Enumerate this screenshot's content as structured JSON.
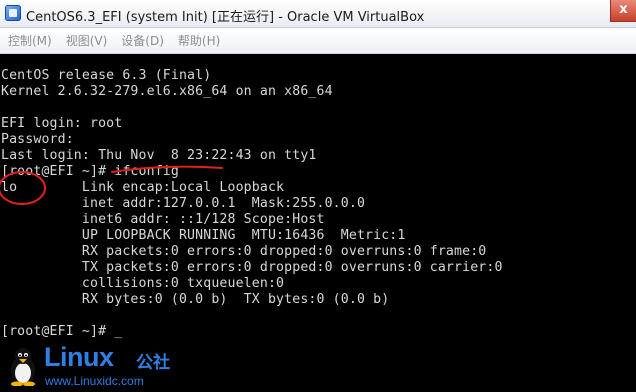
{
  "window": {
    "title": "CentOS6.3_EFI (system Init) [正在运行] - Oracle VM VirtualBox",
    "close_label": "x",
    "app_icon": "virtualbox-icon"
  },
  "menu": {
    "items": [
      {
        "label": "控制(M)"
      },
      {
        "label": "视图(V)"
      },
      {
        "label": "设备(D)"
      },
      {
        "label": "帮助(H)"
      }
    ]
  },
  "console": {
    "lines": [
      "CentOS release 6.3 (Final)",
      "Kernel 2.6.32-279.el6.x86_64 on an x86_64",
      "",
      "EFI login: root",
      "Password:",
      "Last login: Thu Nov  8 23:22:43 on tty1",
      "[root@EFI ~]# ifconfig",
      "lo        Link encap:Local Loopback",
      "          inet addr:127.0.0.1  Mask:255.0.0.0",
      "          inet6 addr: ::1/128 Scope:Host",
      "          UP LOOPBACK RUNNING  MTU:16436  Metric:1",
      "          RX packets:0 errors:0 dropped:0 overruns:0 frame:0",
      "          TX packets:0 errors:0 dropped:0 overruns:0 carrier:0",
      "          collisions:0 txqueuelen:0",
      "          RX bytes:0 (0.0 b)  TX bytes:0 (0.0 b)",
      "",
      "[root@EFI ~]# _"
    ]
  },
  "watermark": {
    "brand": "Linux",
    "suffix": "公社",
    "url": "www.Linuxidc.com",
    "mascot": "tux-penguin-icon"
  },
  "colors": {
    "annotation": "#e0201b",
    "watermark": "#2f7fe4",
    "console_text": "#d8d8d8"
  }
}
